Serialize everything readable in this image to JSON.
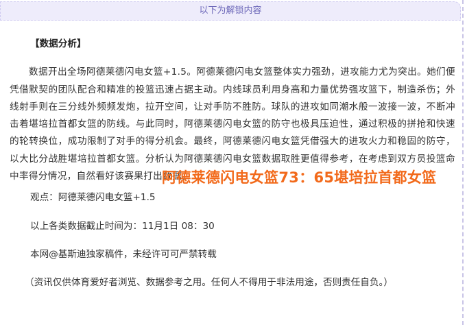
{
  "unlock_banner": "以下为解锁内容",
  "heading": "【数据分析】",
  "analysis_paragraph": "数据开出全场阿德莱德闪电女篮+1.5。阿德莱德闪电女篮整体实力强劲，进攻能力尤为突出。她们便凭借默契的团队配合和精准的投篮迅速占据主动。内线球员利用身高和力量优势强攻篮下，制造杀伤；外线射手则在三分线外频频发炮，拉开空间，让对手防不胜防。球队的进攻如同潮水般一波接一波，不断冲击着堪培拉首都女篮的防线。与此同时，阿德莱德闪电女篮的防守也极具压迫性，通过积极的拼抢和快速的轮转换位，成功限制了对手的得分机会。最终，阿德莱德闪电女篮凭借强大的进攻火力和稳固的防守，以大比分战胜堪培拉首都女篮。分析认为阿德莱德闪电女篮数据取胜更值得参考，在考虑到双方员投篮命中率得分情况，自然看好该赛果打出数据。",
  "score_overlay": "阿德莱德闪电女篮73：65堪培拉首都女篮",
  "viewpoint": "观点：阿德莱德闪电女篮+1.5",
  "cutoff_time": "以上各类数据截止时间为：11月1日 08：30",
  "copyright": "本网@基斯迪独家稿件，未经许可可严禁转载",
  "disclaimer": "（资讯仅供体育爱好者浏览、数据参考之用。任何人不得用于非法用途，否则责任自负。）"
}
